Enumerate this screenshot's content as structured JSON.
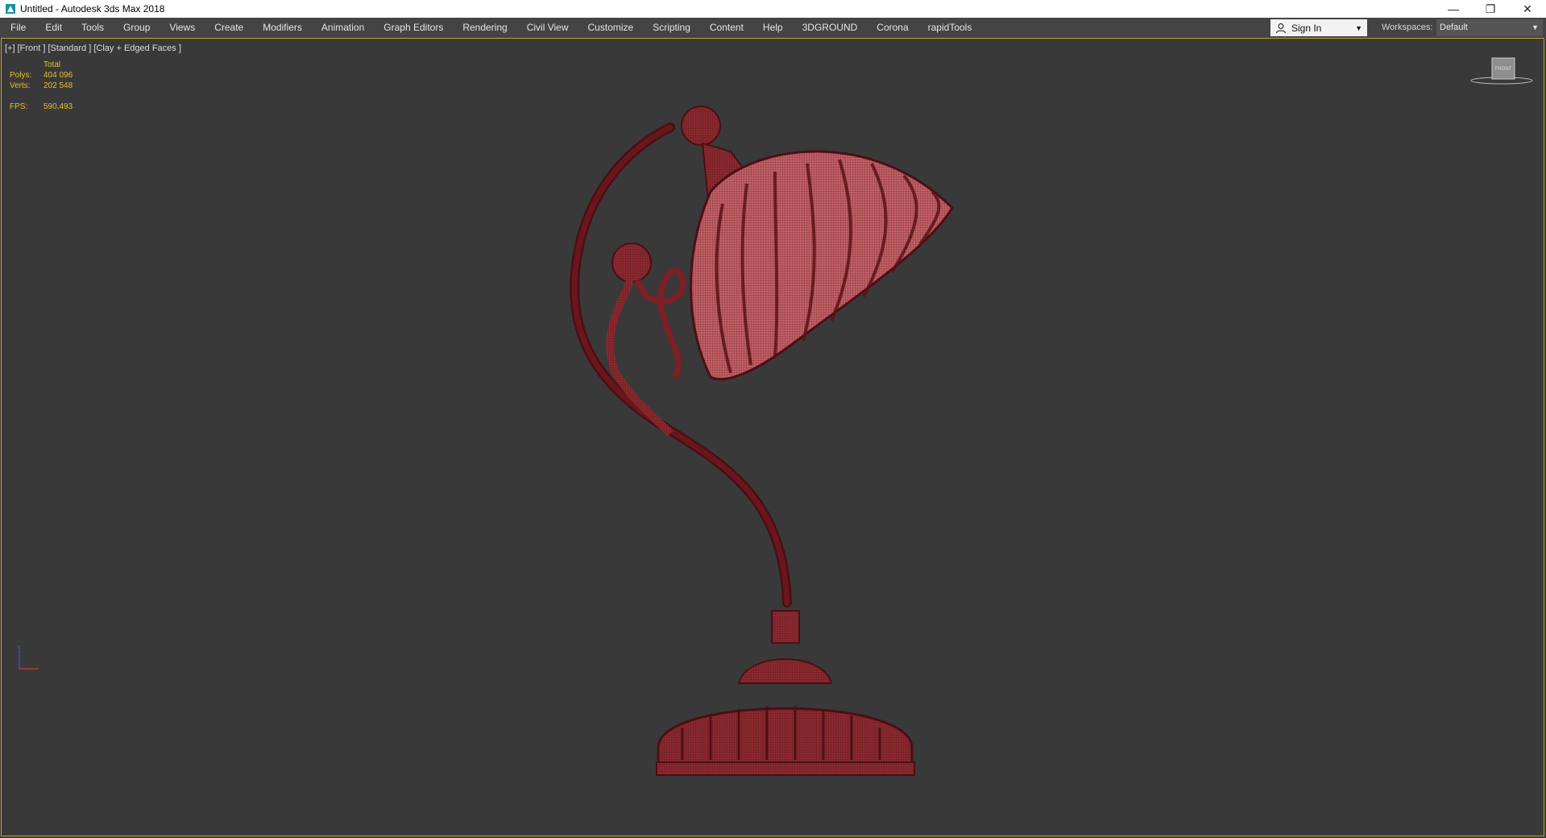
{
  "window": {
    "title": "Untitled - Autodesk 3ds Max 2018",
    "controls": [
      "minimize-icon",
      "restore-icon",
      "close-icon"
    ]
  },
  "menubar": {
    "items": [
      "File",
      "Edit",
      "Tools",
      "Group",
      "Views",
      "Create",
      "Modifiers",
      "Animation",
      "Graph Editors",
      "Rendering",
      "Civil View",
      "Customize",
      "Scripting",
      "Content",
      "Help",
      "3DGROUND",
      "Corona",
      "rapidTools"
    ]
  },
  "signin": {
    "label": "Sign In",
    "icon": "user-icon"
  },
  "workspace": {
    "label": "Workspaces:",
    "value": "Default"
  },
  "viewport": {
    "label": "[+] [Front ] [Standard ] [Clay + Edged Faces ]",
    "viewcube_label": "FRONT",
    "stats": {
      "header": "Total",
      "polys_label": "Polys:",
      "polys_value": "404 096",
      "verts_label": "Verts:",
      "verts_value": "202 548",
      "fps_label": "FPS:",
      "fps_value": "590,493"
    }
  },
  "colors": {
    "viewport_bg": "#393939",
    "stats_text": "#e0c22a",
    "viewport_border": "#c9a227",
    "mesh": "#7a1f24"
  }
}
